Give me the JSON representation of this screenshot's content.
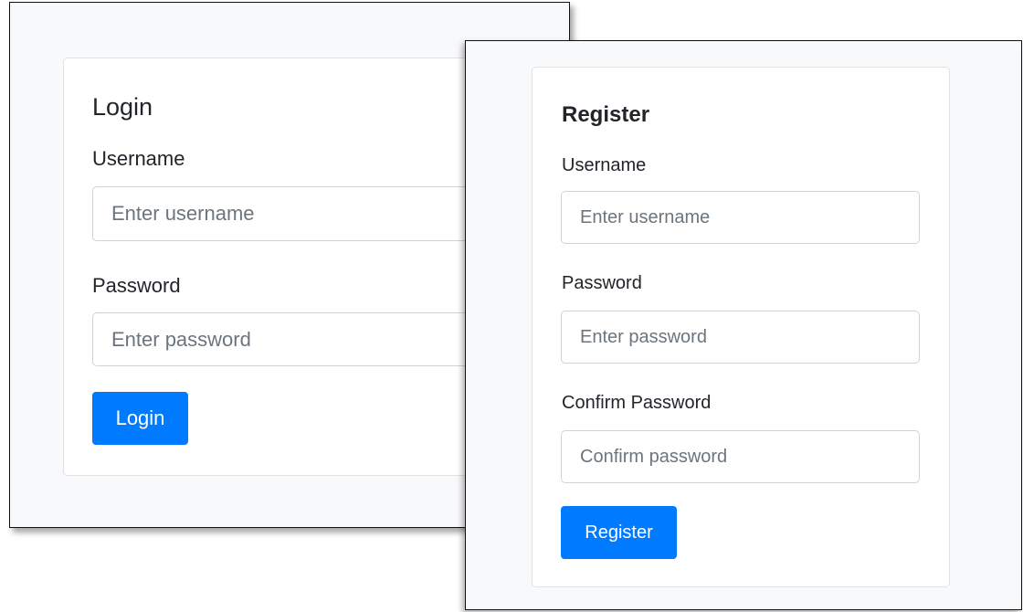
{
  "login": {
    "title": "Login",
    "username_label": "Username",
    "username_placeholder": "Enter username",
    "password_label": "Password",
    "password_placeholder": "Enter password",
    "submit_label": "Login"
  },
  "register": {
    "title": "Register",
    "username_label": "Username",
    "username_placeholder": "Enter username",
    "password_label": "Password",
    "password_placeholder": "Enter password",
    "confirm_label": "Confirm Password",
    "confirm_placeholder": "Confirm password",
    "submit_label": "Register"
  },
  "colors": {
    "primary": "#007bff",
    "window_bg": "#f8f9fa",
    "card_bg": "#ffffff",
    "text": "#212529"
  }
}
